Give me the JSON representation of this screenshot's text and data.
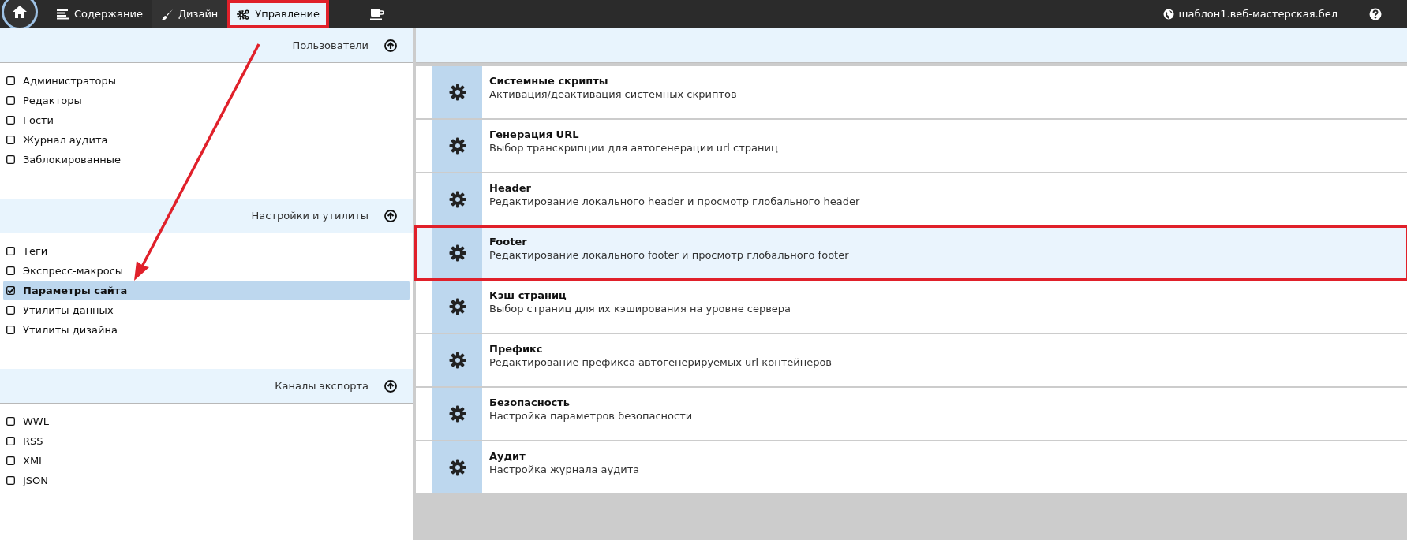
{
  "top_bar": {
    "nav": [
      {
        "label": "Содержание",
        "selected": false,
        "annotated": false
      },
      {
        "label": "Дизайн",
        "selected": false,
        "annotated": false
      },
      {
        "label": "Управление",
        "selected": true,
        "annotated": true
      },
      {
        "selected": false
      }
    ],
    "site": "шаблон1.веб-мастерская.бел"
  },
  "sidebar": {
    "sections": [
      {
        "title": "Пользователи",
        "items": [
          {
            "label": "Администраторы",
            "selected": false
          },
          {
            "label": "Редакторы",
            "selected": false
          },
          {
            "label": "Гости",
            "selected": false
          },
          {
            "label": "Журнал аудита",
            "selected": false
          },
          {
            "label": "Заблокированные",
            "selected": false
          }
        ]
      },
      {
        "title": "Настройки и утилиты",
        "items": [
          {
            "label": "Теги",
            "selected": false
          },
          {
            "label": "Экспресс-макросы",
            "selected": false
          },
          {
            "label": "Параметры сайта",
            "selected": true
          },
          {
            "label": "Утилиты данных",
            "selected": false
          },
          {
            "label": "Утилиты дизайна",
            "selected": false
          }
        ]
      },
      {
        "title": "Каналы экспорта",
        "items": [
          {
            "label": "WWL",
            "selected": false
          },
          {
            "label": "RSS",
            "selected": false
          },
          {
            "label": "XML",
            "selected": false
          },
          {
            "label": "JSON",
            "selected": false
          }
        ]
      }
    ]
  },
  "settings": [
    {
      "title": "Системные скрипты",
      "description": "Активация/деактивация системных скриптов",
      "selected": false,
      "annotated": false
    },
    {
      "title": "Генерация URL",
      "description": "Выбор транскрипции для автогенерации url страниц",
      "selected": false,
      "annotated": false
    },
    {
      "title": "Header",
      "description": "Редактирование локального header и просмотр глобального header",
      "selected": false,
      "annotated": false
    },
    {
      "title": "Footer",
      "description": "Редактирование локального footer и просмотр глобального footer",
      "selected": true,
      "annotated": true
    },
    {
      "title": "Кэш страниц",
      "description": "Выбор страниц для их кэширования на уровне сервера",
      "selected": false,
      "annotated": false
    },
    {
      "title": "Префикс",
      "description": "Редактирование префикса автогенерируемых url контейнеров",
      "selected": false,
      "annotated": false
    },
    {
      "title": "Безопасность",
      "description": "Настройка параметров безопасности",
      "selected": false,
      "annotated": false
    },
    {
      "title": "Аудит",
      "description": "Настройка журнала аудита",
      "selected": false,
      "annotated": false
    }
  ],
  "annotation_arrow": true
}
